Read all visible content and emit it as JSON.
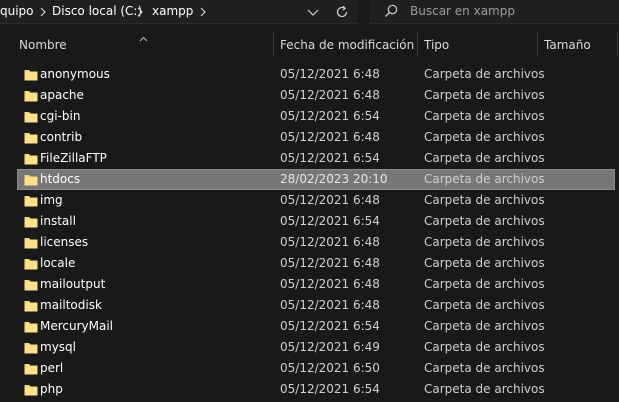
{
  "breadcrumb": {
    "items": [
      "quipo",
      "Disco local (C:)",
      "xampp"
    ]
  },
  "search": {
    "placeholder": "Buscar en xampp"
  },
  "columns": {
    "name": "Nombre",
    "date": "Fecha de modificación",
    "type": "Tipo",
    "size": "Tamaño"
  },
  "files": [
    {
      "name": "anonymous",
      "date": "05/12/2021 6:48",
      "type": "Carpeta de archivos"
    },
    {
      "name": "apache",
      "date": "05/12/2021 6:48",
      "type": "Carpeta de archivos"
    },
    {
      "name": "cgi-bin",
      "date": "05/12/2021 6:54",
      "type": "Carpeta de archivos"
    },
    {
      "name": "contrib",
      "date": "05/12/2021 6:48",
      "type": "Carpeta de archivos"
    },
    {
      "name": "FileZillaFTP",
      "date": "05/12/2021 6:54",
      "type": "Carpeta de archivos"
    },
    {
      "name": "htdocs",
      "date": "28/02/2023 20:10",
      "type": "Carpeta de archivos",
      "selected": true
    },
    {
      "name": "img",
      "date": "05/12/2021 6:48",
      "type": "Carpeta de archivos"
    },
    {
      "name": "install",
      "date": "05/12/2021 6:54",
      "type": "Carpeta de archivos"
    },
    {
      "name": "licenses",
      "date": "05/12/2021 6:48",
      "type": "Carpeta de archivos"
    },
    {
      "name": "locale",
      "date": "05/12/2021 6:48",
      "type": "Carpeta de archivos"
    },
    {
      "name": "mailoutput",
      "date": "05/12/2021 6:48",
      "type": "Carpeta de archivos"
    },
    {
      "name": "mailtodisk",
      "date": "05/12/2021 6:48",
      "type": "Carpeta de archivos"
    },
    {
      "name": "MercuryMail",
      "date": "05/12/2021 6:54",
      "type": "Carpeta de archivos"
    },
    {
      "name": "mysql",
      "date": "05/12/2021 6:49",
      "type": "Carpeta de archivos"
    },
    {
      "name": "perl",
      "date": "05/12/2021 6:50",
      "type": "Carpeta de archivos"
    },
    {
      "name": "php",
      "date": "05/12/2021 6:54",
      "type": "Carpeta de archivos"
    }
  ],
  "colors": {
    "background": "#191919",
    "folder": "#f8d775",
    "selection": "#777777"
  }
}
